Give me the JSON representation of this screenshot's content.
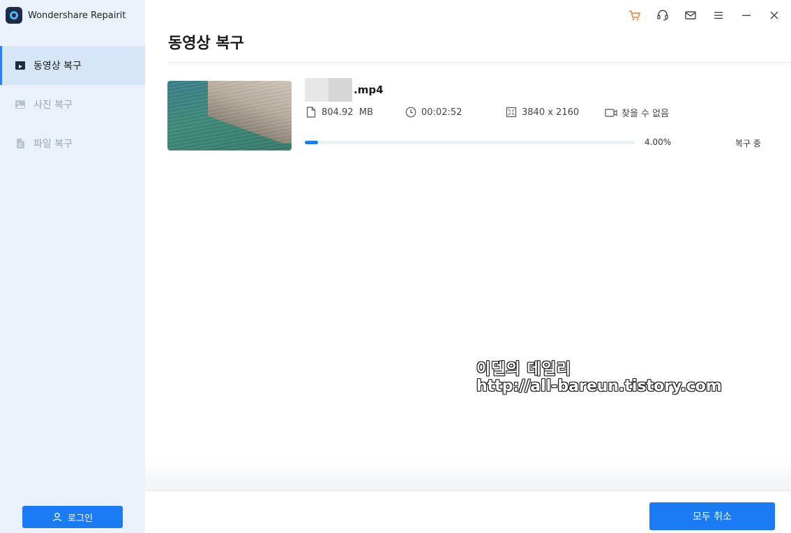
{
  "app": {
    "title": "Wondershare Repairit"
  },
  "sidebar": {
    "items": [
      {
        "label": "동영상 복구",
        "icon": "video-icon",
        "active": true
      },
      {
        "label": "사진 복구",
        "icon": "photo-icon",
        "active": false
      },
      {
        "label": "파일 복구",
        "icon": "file-icon",
        "active": false
      }
    ],
    "login_label": "로그인"
  },
  "header": {
    "icons": [
      "cart-icon",
      "headset-icon",
      "mail-icon",
      "menu-icon",
      "minimize-icon",
      "close-icon"
    ]
  },
  "main": {
    "title": "동영상 복구",
    "file": {
      "name": ".mp4",
      "size": "804.92  MB",
      "duration": "00:02:52",
      "resolution": "3840 x 2160",
      "camera": "찾을 수 없음",
      "progress": 0.04,
      "progress_label": "4.00%",
      "status": "복구 중"
    }
  },
  "watermark": {
    "line1": "이델의 데일리",
    "line2": "http://all-bareun.tistory.com"
  },
  "footer": {
    "cancel_all_label": "모두 취소"
  },
  "colors": {
    "accent": "#1a7bf5",
    "sidebar_bg": "#eaf1fa",
    "active_bg": "#d7e6f7",
    "cart": "#f07a2a"
  }
}
